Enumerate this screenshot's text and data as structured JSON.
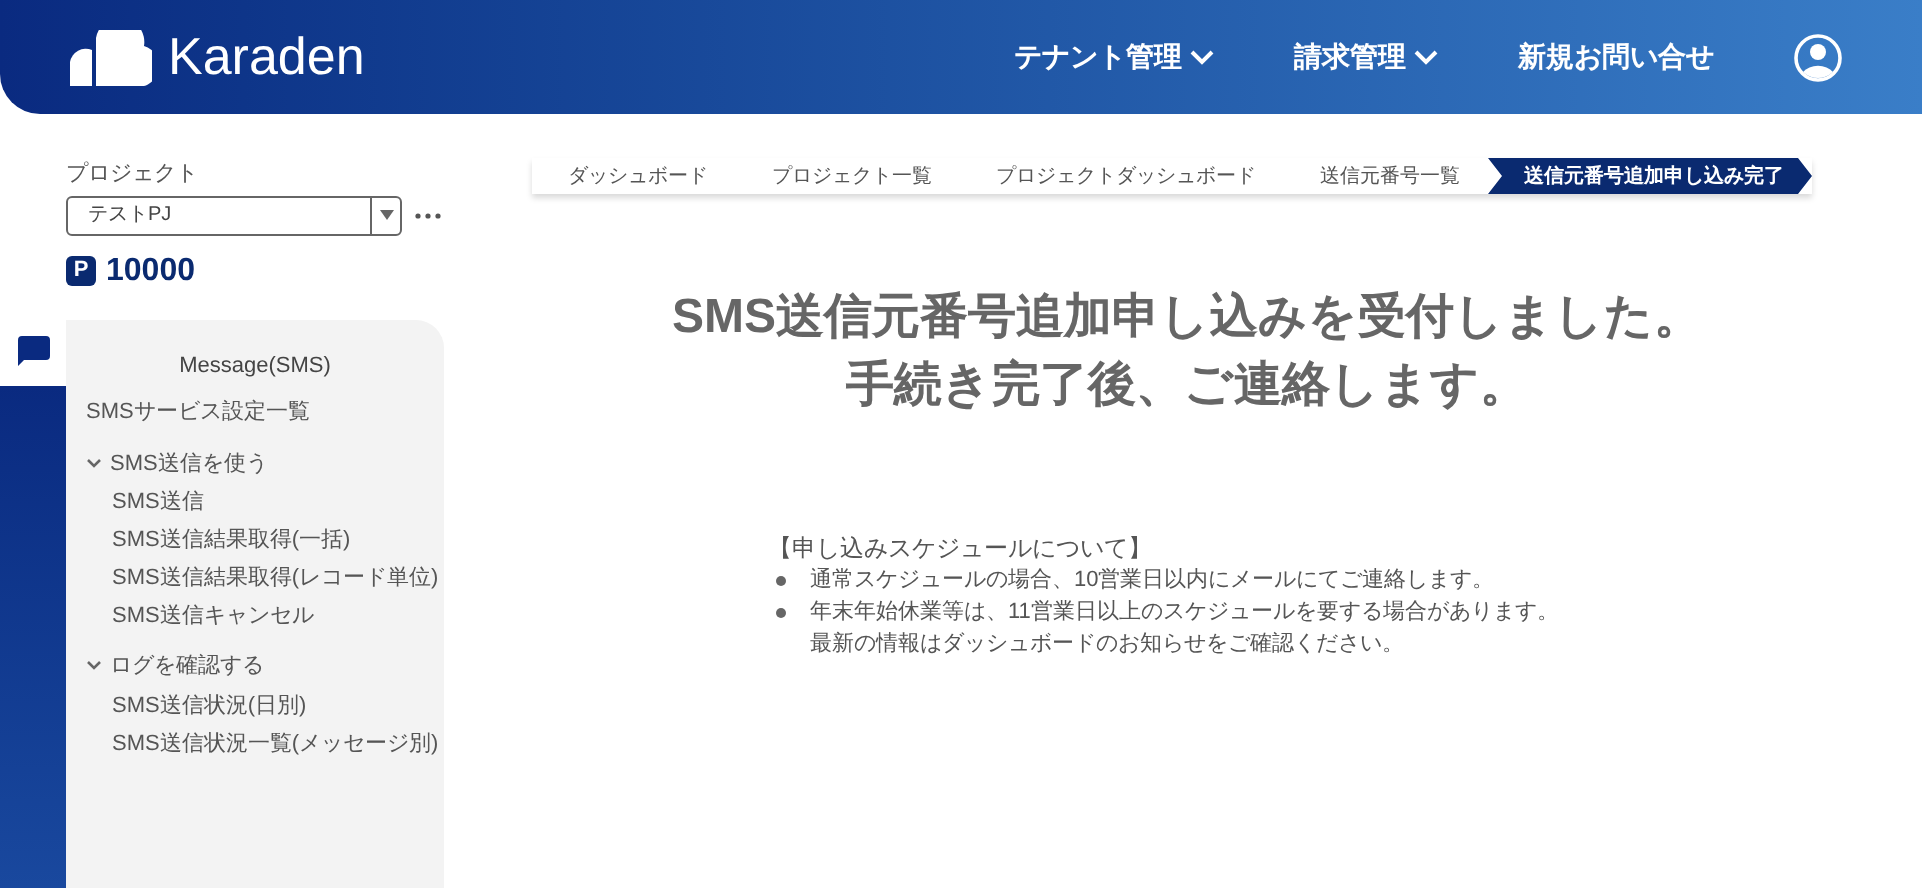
{
  "header": {
    "logo": "Karaden",
    "nav": [
      {
        "label": "テナント管理",
        "dropdown": true
      },
      {
        "label": "請求管理",
        "dropdown": true
      },
      {
        "label": "新規お問い合せ",
        "dropdown": false
      }
    ]
  },
  "project": {
    "label": "プロジェクト",
    "value": "テストPJ",
    "points_badge": "P",
    "points": "10000"
  },
  "sidebar": {
    "title": "Message(SMS)",
    "items": [
      {
        "label": "SMSサービス設定一覧"
      },
      {
        "label": "SMS送信を使う",
        "expanded": true,
        "children": [
          {
            "label": "SMS送信"
          },
          {
            "label": "SMS送信結果取得(一括)"
          },
          {
            "label": "SMS送信結果取得(レコード単位)"
          },
          {
            "label": "SMS送信キャンセル"
          }
        ]
      },
      {
        "label": "ログを確認する",
        "expanded": true,
        "children": [
          {
            "label": "SMS送信状況(日別)"
          },
          {
            "label": "SMS送信状況一覧(メッセージ別)"
          }
        ]
      }
    ]
  },
  "breadcrumbs": [
    {
      "label": "ダッシュボード",
      "selected": false
    },
    {
      "label": "プロジェクト一覧",
      "selected": false
    },
    {
      "label": "プロジェクトダッシュボード",
      "selected": false
    },
    {
      "label": "送信元番号一覧",
      "selected": false
    },
    {
      "label": "送信元番号追加申し込み完了",
      "selected": true
    }
  ],
  "message": {
    "lines": [
      "SMS送信元番号追加申し込みを受付しました。",
      "手続き完了後、ご連絡します。"
    ]
  },
  "schedule": {
    "heading": "【申し込みスケジュールについて】",
    "bullets": [
      {
        "lines": [
          "通常スケジュールの場合、10営業日以内にメールにてご連絡します。"
        ]
      },
      {
        "lines": [
          "年末年始休業等は、11営業日以上のスケジュールを要する場合があります。",
          "最新の情報はダッシュボードのお知らせをご確認ください。"
        ]
      }
    ]
  }
}
